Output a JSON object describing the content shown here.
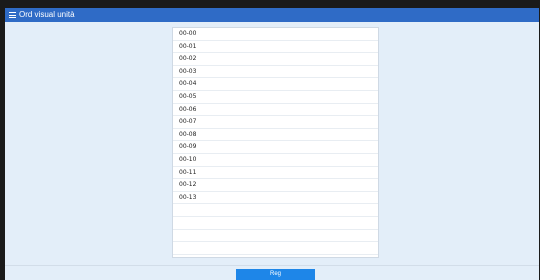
{
  "window": {
    "title": "Ord visual unità",
    "menu_icon": "hamburger-menu-icon"
  },
  "list": {
    "items": [
      "00-00",
      "00-01",
      "00-02",
      "00-03",
      "00-04",
      "00-05",
      "00-06",
      "00-07",
      "00-08",
      "00-09",
      "00-10",
      "00-11",
      "00-12",
      "00-13",
      "",
      "",
      "",
      "",
      ""
    ]
  },
  "footer": {
    "reg_label": "Reg"
  },
  "colors": {
    "titlebar": "#2f6bc6",
    "background": "#e3eef9",
    "button": "#1e86e8"
  }
}
